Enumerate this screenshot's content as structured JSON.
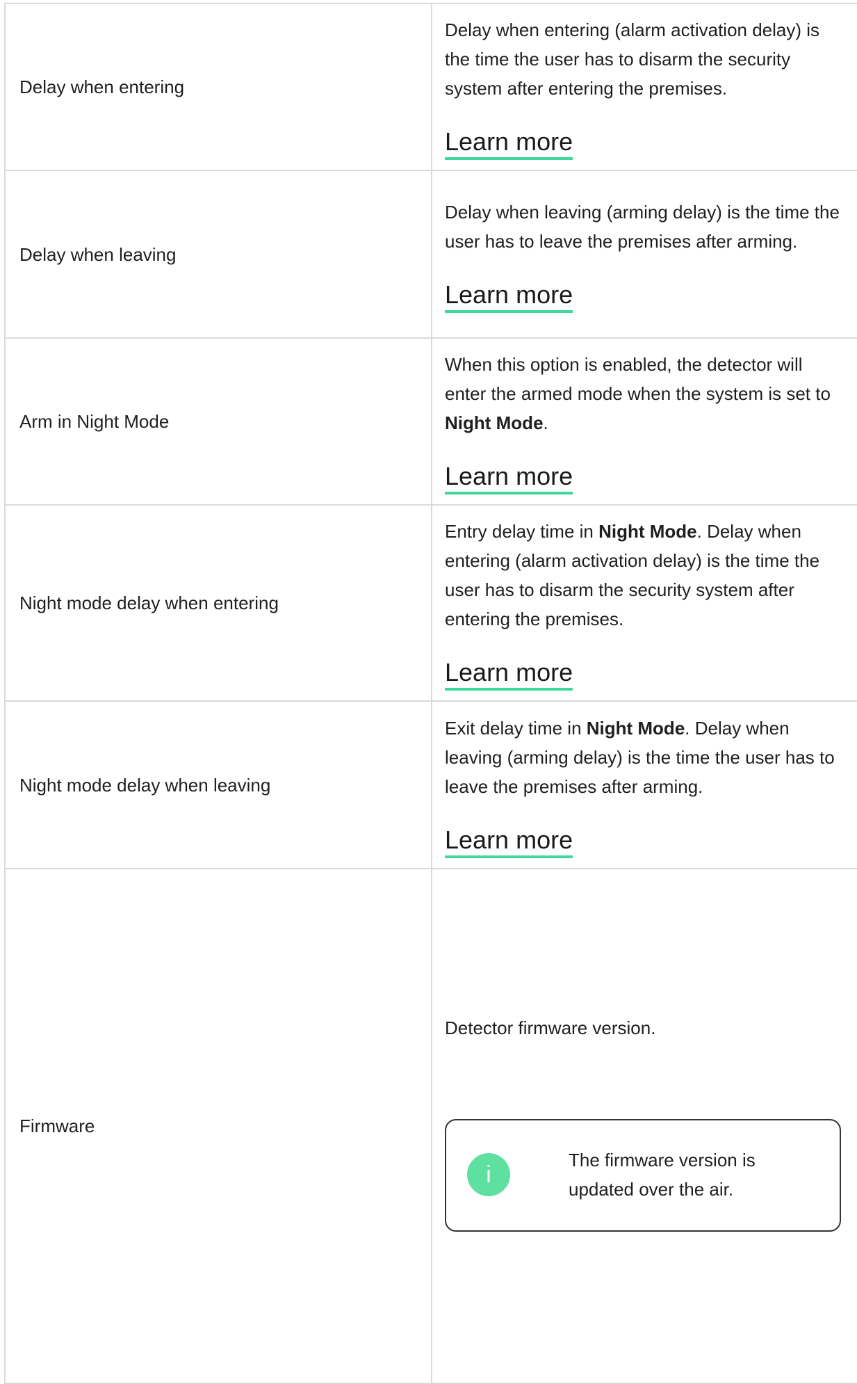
{
  "learn_more_label": "Learn more",
  "rows": [
    {
      "name": "Delay when entering",
      "desc": "Delay when entering (alarm activation delay) is the time the user has to disarm the security system after entering the premises."
    },
    {
      "name": "Delay when leaving",
      "desc": "Delay when leaving (arming delay) is the time the user has to leave the premises after arming."
    },
    {
      "name": "Arm in Night Mode",
      "desc_before": "When this option is enabled, the detector will enter the armed mode when the system is set to ",
      "desc_bold": "Night Mode",
      "desc_after": "."
    },
    {
      "name": "Night mode delay when entering",
      "desc_before": "Entry delay time in ",
      "desc_bold": "Night Mode",
      "desc_after": ". Delay when entering (alarm activation delay) is the time the user has to disarm the security system after entering the premises."
    },
    {
      "name": "Night mode delay when leaving",
      "desc_before": "Exit delay time in ",
      "desc_bold": "Night Mode",
      "desc_after": ". Delay when leaving (arming delay) is the time the user has to leave the premises after arming."
    },
    {
      "name": "Firmware",
      "desc": "Detector firmware version.",
      "note": {
        "icon": "info-icon",
        "icon_glyph": "i",
        "text": "The firmware version is updated over the air."
      }
    }
  ],
  "colors": {
    "accent": "#3fd89a",
    "info_icon_bg": "#5ee0a0",
    "border": "#dadada"
  }
}
